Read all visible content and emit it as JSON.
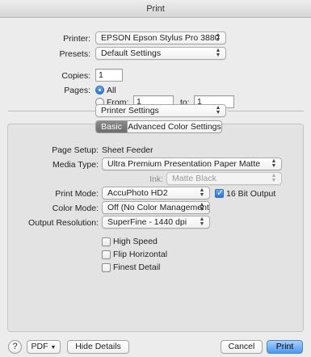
{
  "window": {
    "title": "Print"
  },
  "printer": {
    "label": "Printer:",
    "value": "EPSON Epson Stylus Pro 3880"
  },
  "presets": {
    "label": "Presets:",
    "value": "Default Settings"
  },
  "copies": {
    "label": "Copies:",
    "value": "1"
  },
  "pages": {
    "label": "Pages:",
    "all_label": "All",
    "from_label": "From:",
    "from_value": "1",
    "to_label": "to:",
    "to_value": "1",
    "selected": "All"
  },
  "section_popup": {
    "value": "Printer Settings"
  },
  "tabs": [
    {
      "label": "Basic",
      "active": true
    },
    {
      "label": "Advanced Color Settings",
      "active": false
    }
  ],
  "settings": {
    "page_setup": {
      "label": "Page Setup:",
      "value": "Sheet Feeder"
    },
    "media_type": {
      "label": "Media Type:",
      "value": "Ultra Premium Presentation Paper Matte"
    },
    "ink": {
      "label": "Ink:",
      "value": "Matte Black"
    },
    "print_mode": {
      "label": "Print Mode:",
      "value": "AccuPhoto HD2"
    },
    "bit_output": {
      "label": "16 Bit Output",
      "checked": true
    },
    "color_mode": {
      "label": "Color Mode:",
      "value": "Off (No Color Management)"
    },
    "output_resolution": {
      "label": "Output Resolution:",
      "value": "SuperFine - 1440 dpi"
    },
    "options": [
      {
        "label": "High Speed",
        "checked": false
      },
      {
        "label": "Flip Horizontal",
        "checked": false
      },
      {
        "label": "Finest Detail",
        "checked": false
      }
    ]
  },
  "footer": {
    "help_glyph": "?",
    "pdf_label": "PDF",
    "hide_details_label": "Hide Details",
    "cancel_label": "Cancel",
    "print_label": "Print"
  },
  "colors": {
    "accent": "#2c74d6",
    "default_button": "#4d97ee"
  }
}
